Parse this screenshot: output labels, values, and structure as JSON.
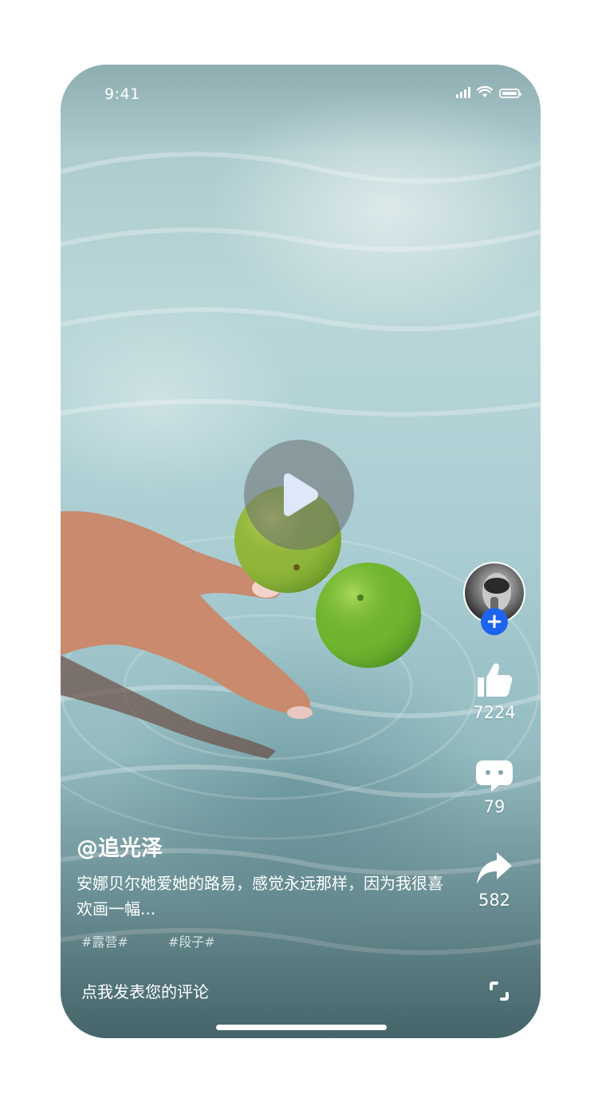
{
  "status_bar": {
    "time": "9:41"
  },
  "video": {
    "play_icon": "play-icon"
  },
  "author": {
    "avatar": "avatar",
    "follow_symbol": "+"
  },
  "actions": {
    "likes": "7224",
    "comments": "79",
    "shares": "582"
  },
  "post": {
    "username": "@追光泽",
    "description": "安娜贝尔她爱她的路易，感觉永远那样，因为我很喜欢画一幅...",
    "tags": [
      "#露营#",
      "#段子#"
    ]
  },
  "comment_bar": {
    "placeholder": "点我发表您的评论"
  },
  "colors": {
    "accent": "#1e62f0",
    "text": "#ffffff"
  }
}
